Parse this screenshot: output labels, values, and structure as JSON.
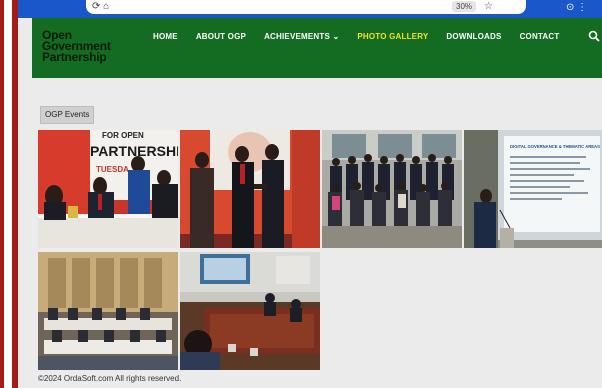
{
  "browser": {
    "nav_glyph": "⟳ ⌂",
    "zoom_badge": "30%",
    "star_glyph": "☆",
    "right_glyphs": "⊙ ⋮"
  },
  "site": {
    "logo_lines": [
      "Open",
      "Government",
      "Partnership"
    ],
    "nav": [
      {
        "label": "HOME",
        "active": false
      },
      {
        "label": "ABOUT OGP",
        "active": false
      },
      {
        "label": "ACHIEVEMENTS ⌄",
        "active": false
      },
      {
        "label": "PHOTO GALLERY",
        "active": true
      },
      {
        "label": "DOWNLOADS",
        "active": false
      },
      {
        "label": "CONTACT",
        "active": false
      }
    ],
    "search_icon": "search-icon",
    "accent_color": "#146c23",
    "active_color": "#f2e21c"
  },
  "gallery": {
    "category": "OGP Events",
    "photos": [
      {
        "id": "photo-1",
        "banner_text": "PARTNERSHIP",
        "banner_top": "FOR OPEN",
        "date_text": "TUESDA"
      },
      {
        "id": "photo-2"
      },
      {
        "id": "photo-3"
      },
      {
        "id": "photo-4",
        "slide_title": "DIGITAL GOVERNANCE & THEMATIC AREAS"
      },
      {
        "id": "photo-5"
      },
      {
        "id": "photo-6"
      }
    ]
  },
  "footer": {
    "copyright": "©2024 OrdaSoft.com All rights reserved."
  }
}
